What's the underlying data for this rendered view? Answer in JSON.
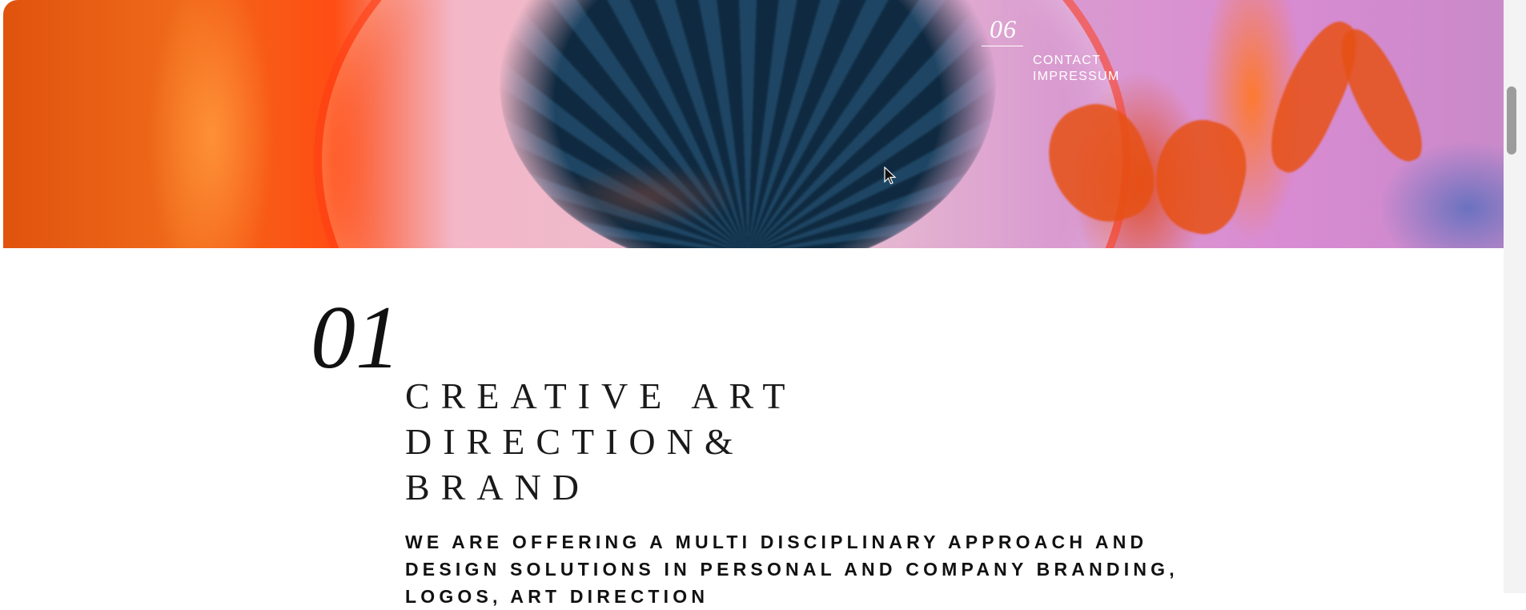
{
  "hero": {
    "nav_number": "06",
    "nav_links": [
      "CONTACT",
      "IMPRESSUM"
    ],
    "image_icon": "hero-image"
  },
  "section": {
    "number": "01",
    "title_lines": [
      "CREATIVE ART",
      "DIRECTION&",
      "BRAND"
    ],
    "lead": "WE ARE OFFERING A MULTI DISCIPLINARY APPROACH AND DESIGN SOLUTIONS IN PERSONAL AND COMPANY BRANDING, LOGOS, ART DIRECTION"
  },
  "colors": {
    "text": "#111111",
    "background": "#ffffff",
    "nav_text": "#ffffff"
  },
  "icons": {
    "cursor": "mouse-cursor-icon"
  }
}
